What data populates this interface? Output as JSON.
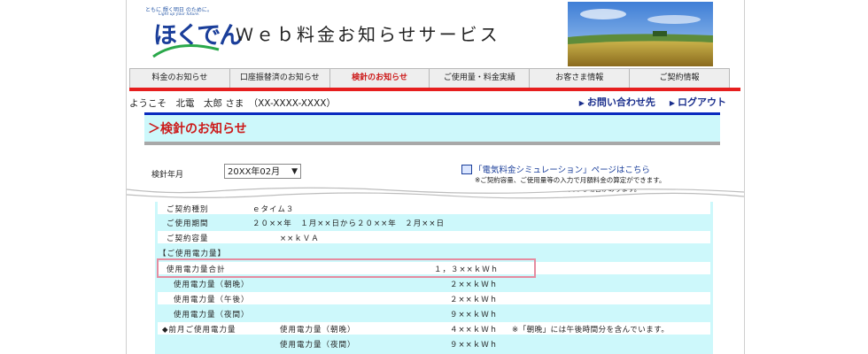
{
  "header": {
    "tagline": "ともに 輝く明日 のために。",
    "tagline_en": "Light up your future.",
    "logo_text": "ほくでん",
    "site_title": "Ｗｅｂ料金お知らせサービス"
  },
  "nav": {
    "items": [
      {
        "label": "料金のお知らせ"
      },
      {
        "label": "口座振替済のお知らせ"
      },
      {
        "label": "検針のお知らせ"
      },
      {
        "label": "ご使用量・料金実績"
      },
      {
        "label": "お客さま情報"
      },
      {
        "label": "ご契約情報"
      }
    ],
    "active_index": 2
  },
  "user": {
    "welcome": "ようこそ　北電　太郎 さま　（XX-XXXX-XXXX）"
  },
  "links": {
    "contact": "お問い合わせ先",
    "logout": "ログアウト"
  },
  "section": {
    "title": "＞検針のお知らせ"
  },
  "filters": {
    "year_month_label": "検針年月",
    "year_month_value": "20XX年02月"
  },
  "simulation": {
    "link": "「電気料金シミュレーション」ページはこちら",
    "note1": "※ご契約容量、ご使用量等の入力で月額料金の算定ができます。",
    "note2": "ただし、実際のご請求額とは異なる場合があります。"
  },
  "details": {
    "contract_type_label": "ご契約種別",
    "contract_type_value": "ｅタイム３",
    "period_label": "ご使用期間",
    "period_value": "２０××年　１月××日から２０××年　２月××日",
    "capacity_label": "ご契約容量",
    "capacity_value": "××ｋＶＡ",
    "usage_header": "【ご使用電力量】",
    "total_label": "使用電力量合計",
    "total_value": "１，３××ｋＷｈ",
    "morning_label": "使用電力量（朝晩）",
    "morning_value": "２××ｋＷｈ",
    "afternoon_label": "使用電力量（午後）",
    "afternoon_value": "２××ｋＷｈ",
    "night_label": "使用電力量（夜間）",
    "night_value": "９××ｋＷｈ",
    "prev_label": "◆前月ご使用電力量",
    "prev_morning_label": "使用電力量（朝晩）",
    "prev_morning_value": "４××ｋＷｈ",
    "prev_note": "※「朝晩」には午後時間分を含んでいます。",
    "prev_night_label": "使用電力量（夜間）",
    "prev_night_value": "９××ｋＷｈ"
  }
}
